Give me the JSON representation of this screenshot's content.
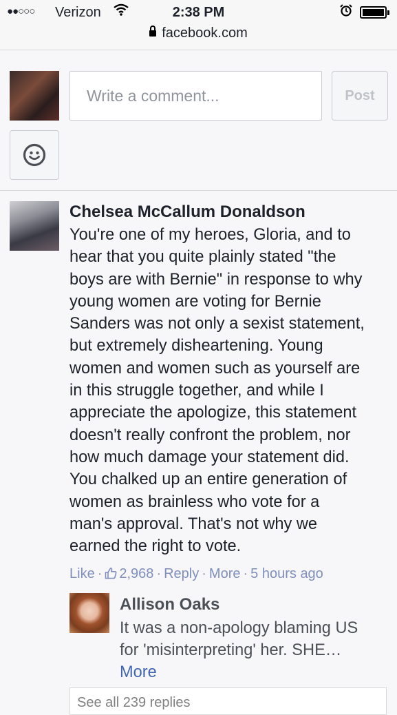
{
  "status_bar": {
    "signal": "●●○○○",
    "carrier": "Verizon",
    "time": "2:38 PM",
    "url": "facebook.com"
  },
  "composer": {
    "placeholder": "Write a comment...",
    "post_label": "Post"
  },
  "comment": {
    "author": "Chelsea McCallum Donaldson",
    "lines": [
      "You're one of my heroes, Gloria, and to",
      "hear that you quite plainly stated \"the",
      "boys are with Bernie\" in response to why",
      "young women are voting for Bernie",
      "Sanders was not only a sexist statement,",
      "but extremely disheartening. Young",
      "women and women such as yourself are",
      "in this struggle together, and while I",
      "appreciate the apologize, this statement",
      "doesn't really confront the problem, nor",
      "how much damage your statement did.",
      "You chalked up an entire generation of",
      "women as brainless who vote for a",
      "man's approval. That's not why we",
      "earned the right to vote."
    ],
    "like_label": "Like",
    "like_count": "2,968",
    "reply_label": "Reply",
    "more_label": "More",
    "time_ago": "5 hours ago",
    "separator": "·"
  },
  "reply": {
    "author": "Allison Oaks",
    "lines": [
      "It was a non-apology blaming US",
      "for 'misinterpreting' her. SHE…"
    ],
    "more_label": "More"
  },
  "see_all_replies": "See all 239 replies",
  "colors": {
    "link_blue": "#4267b2",
    "muted_link": "#7f8fbd",
    "text": "#1d2129"
  },
  "icons": [
    "signal-dots-icon",
    "wifi-icon",
    "alarm-clock-icon",
    "battery-icon",
    "lock-icon",
    "smiley-icon",
    "thumbs-up-icon"
  ]
}
